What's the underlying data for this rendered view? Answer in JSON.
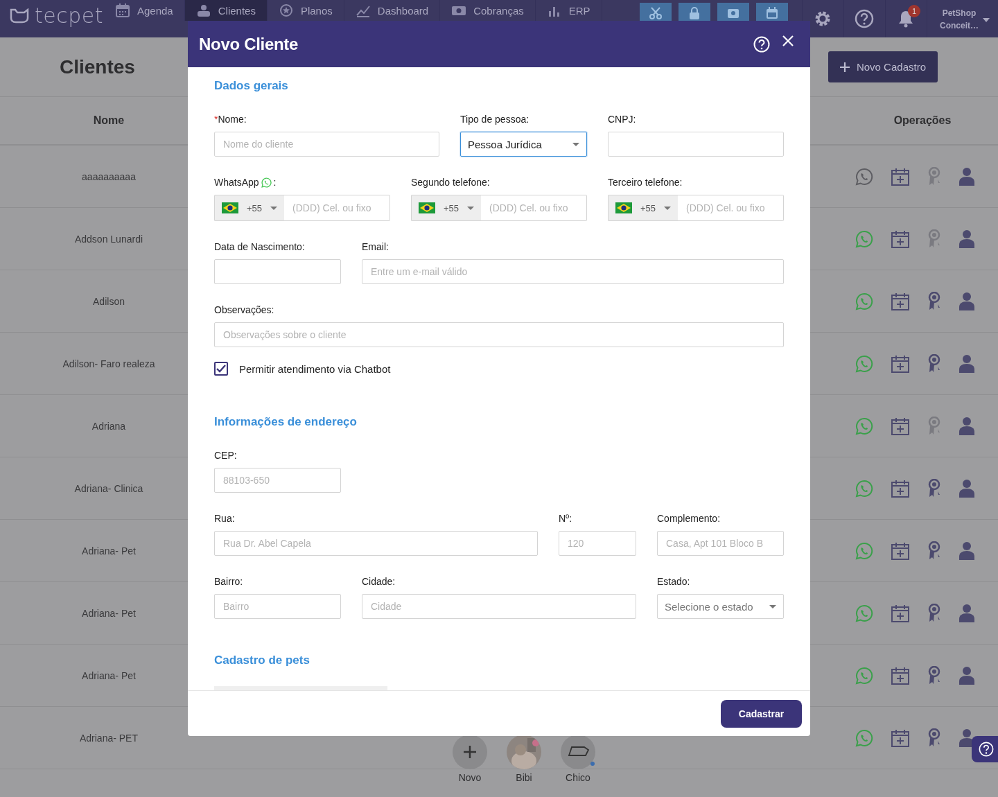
{
  "navbar": {
    "brand": "tecpet",
    "items": [
      {
        "label": "Agenda",
        "selected": false
      },
      {
        "label": "Clientes",
        "selected": true
      },
      {
        "label": "Planos",
        "selected": false
      },
      {
        "label": "Dashboard",
        "selected": false
      },
      {
        "label": "Cobranças",
        "selected": false
      },
      {
        "label": "ERP",
        "selected": false
      }
    ],
    "notification_count": "1",
    "user": [
      "PetShop",
      "Conceit…"
    ]
  },
  "page": {
    "title": "Clientes",
    "new_button": "Novo Cadastro",
    "columns": [
      "Nome",
      "Operações"
    ],
    "rows": [
      {
        "name": "aaaaaaaaaa",
        "whatsapp_linked": false,
        "loyalty_active": false
      },
      {
        "name": "Addson Lunardi",
        "whatsapp_linked": true,
        "loyalty_active": false
      },
      {
        "name": "Adilson",
        "whatsapp_linked": true,
        "loyalty_active": true
      },
      {
        "name": "Adilson- Faro realeza",
        "whatsapp_linked": true,
        "loyalty_active": true
      },
      {
        "name": "Adriana",
        "whatsapp_linked": true,
        "loyalty_active": false
      },
      {
        "name": "Adriana- Clinica",
        "whatsapp_linked": true,
        "loyalty_active": true
      },
      {
        "name": "Adriana- Pet",
        "whatsapp_linked": true,
        "loyalty_active": true
      },
      {
        "name": "Adriana- Pet",
        "whatsapp_linked": true,
        "loyalty_active": true
      },
      {
        "name": "Adriana- Pet",
        "whatsapp_linked": true,
        "loyalty_active": true
      },
      {
        "name": "Adriana- PET",
        "whatsapp_linked": true,
        "loyalty_active": true,
        "pets": [
          {
            "name": "Novo",
            "kind": "add"
          },
          {
            "name": "Bibi"
          },
          {
            "name": "Chico",
            "kind": "drawing"
          }
        ]
      }
    ]
  },
  "modal": {
    "title": "Novo Cliente",
    "sections": [
      {
        "title": "Dados gerais",
        "rows": [
          [
            {
              "kind": "text",
              "required_mark": "*",
              "label": "Nome:",
              "focused": false,
              "placeholder": "Nome do cliente"
            },
            {
              "kind": "select",
              "label": "Tipo de pessoa:",
              "focused": true,
              "value": "Pessoa Jurídica"
            },
            {
              "kind": "text",
              "label": "CNPJ:",
              "focused": false
            }
          ],
          [
            {
              "kind": "whatsapp_phone",
              "label": "WhatsApp",
              "label_end": ":",
              "focused": false,
              "country_code": "+55",
              "placeholder": "(DDD) Cel. ou fixo"
            },
            {
              "kind": "phone",
              "label": "Segundo telefone:",
              "focused": false,
              "country_code": "+55",
              "placeholder": "(DDD) Cel. ou fixo"
            },
            {
              "kind": "phone",
              "label": "Terceiro telefone:",
              "focused": false,
              "country_code": "+55",
              "placeholder": "(DDD) Cel. ou fixo"
            }
          ],
          [
            {
              "kind": "text",
              "label": "Data de Nascimento:",
              "focused": false
            },
            {
              "kind": "text",
              "label": "Email:",
              "focused": false,
              "placeholder": "Entre um e-mail válido"
            }
          ],
          [
            {
              "kind": "text",
              "label": "Observações:",
              "focused": false,
              "placeholder": "Observações sobre o cliente"
            }
          ],
          [
            {
              "kind": "checkbox",
              "label": "Permitir atendimento via Chatbot",
              "checked": true
            }
          ]
        ]
      },
      {
        "title": "Informações de endereço",
        "rows": [
          [
            {
              "kind": "text",
              "label": "CEP:",
              "focused": false,
              "placeholder": "88103-650"
            }
          ],
          [
            {
              "kind": "text",
              "label": "Rua:",
              "focused": false,
              "placeholder": "Rua Dr. Abel Capela"
            },
            {
              "kind": "text",
              "label": "Nº:",
              "focused": false,
              "placeholder": "120"
            },
            {
              "kind": "text",
              "label": "Complemento:",
              "focused": false,
              "placeholder": "Casa, Apt 101 Bloco B"
            }
          ],
          [
            {
              "kind": "text",
              "label": "Bairro:",
              "focused": false,
              "placeholder": "Bairro"
            },
            {
              "kind": "text",
              "label": "Cidade:",
              "focused": false,
              "placeholder": "Cidade"
            },
            {
              "kind": "select",
              "label": "Estado:",
              "focused": false,
              "placeholder": "Selecione o estado"
            }
          ]
        ]
      },
      {
        "title": "Cadastro de pets"
      }
    ],
    "submit": "Cadastrar"
  }
}
